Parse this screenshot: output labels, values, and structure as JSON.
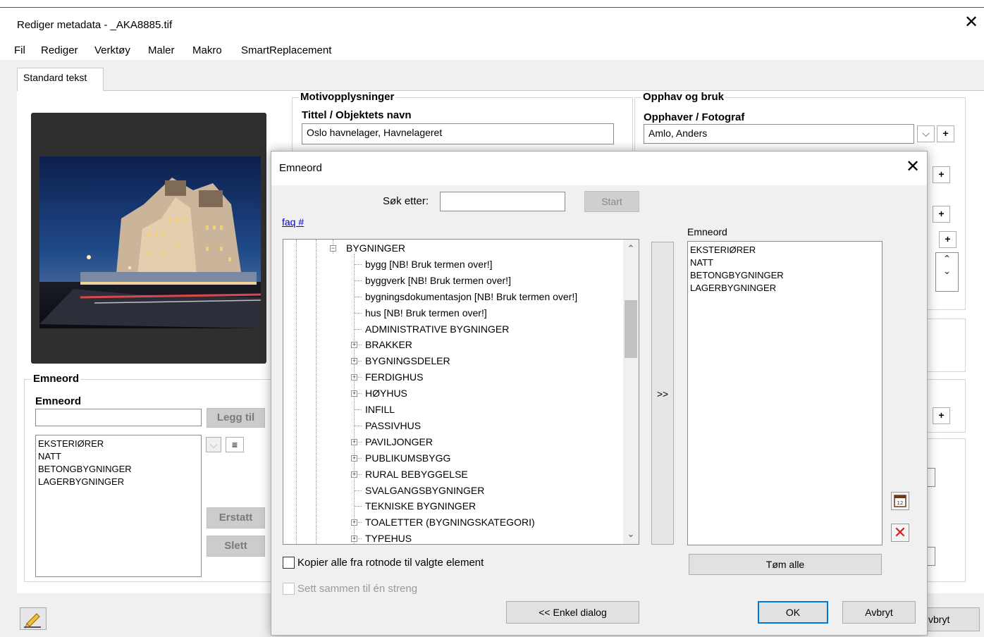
{
  "window": {
    "title": "Rediger metadata - _AKA8885.tif",
    "close": "✕"
  },
  "menu": [
    "Fil",
    "Rediger",
    "Verktøy",
    "Maler",
    "Makro",
    "SmartReplacement"
  ],
  "tab": "Standard tekst",
  "motiv": {
    "group": "Motivopplysninger",
    "title_label": "Tittel / Objektets navn",
    "title_value": "Oslo havnelager, Havnelageret"
  },
  "opphav": {
    "group": "Opphav og bruk",
    "photographer_label": "Opphaver / Fotograf",
    "photographer_value": "Amlo, Anders",
    "dropdown": "⌵",
    "plus": "+",
    "up": "⌃",
    "down": "⌄"
  },
  "emneord_panel": {
    "group": "Emneord",
    "label": "Emneord",
    "input_value": "",
    "add_button": "Legg til",
    "list": [
      "EKSTERIØRER",
      "NATT",
      "BETONGBYGNINGER",
      "LAGERBYGNINGER"
    ],
    "replace_button": "Erstatt",
    "delete_button": "Slett",
    "sort_icon": "≡"
  },
  "footer": {
    "cancel_partial": "vbryt"
  },
  "dialog": {
    "title": "Emneord",
    "close": "✕",
    "search_label": "Søk etter:",
    "search_value": "",
    "start_button": "Start",
    "link": "faq #",
    "transfer_button": ">>",
    "selected_label": "Emneord",
    "selected": [
      "EKSTERIØRER",
      "NATT",
      "BETONGBYGNINGER",
      "LAGERBYGNINGER"
    ],
    "tree": {
      "root": "BYGNINGER",
      "children": [
        {
          "label": "bygg [NB! Bruk termen over!]",
          "expandable": false
        },
        {
          "label": "byggverk [NB! Bruk termen over!]",
          "expandable": false
        },
        {
          "label": "bygningsdokumentasjon [NB! Bruk termen over!]",
          "expandable": false
        },
        {
          "label": "hus [NB! Bruk termen over!]",
          "expandable": false
        },
        {
          "label": "ADMINISTRATIVE BYGNINGER",
          "expandable": false
        },
        {
          "label": "BRAKKER",
          "expandable": true
        },
        {
          "label": "BYGNINGSDELER",
          "expandable": true
        },
        {
          "label": "FERDIGHUS",
          "expandable": true
        },
        {
          "label": "HØYHUS",
          "expandable": true
        },
        {
          "label": "INFILL",
          "expandable": false
        },
        {
          "label": "PASSIVHUS",
          "expandable": false
        },
        {
          "label": "PAVILJONGER",
          "expandable": true
        },
        {
          "label": "PUBLIKUMSBYGG",
          "expandable": true
        },
        {
          "label": "RURAL BEBYGGELSE",
          "expandable": true
        },
        {
          "label": "SVALGANGSBYGNINGER",
          "expandable": false
        },
        {
          "label": "TEKNISKE BYGNINGER",
          "expandable": false
        },
        {
          "label": "TOALETTER (BYGNINGSKATEGORI)",
          "expandable": true
        },
        {
          "label": "TYPEHUS",
          "expandable": true
        }
      ]
    },
    "checkbox_copy": "Kopier alle fra rotnode til valgte element",
    "checkbox_join": "Sett sammen til én streng",
    "clear_button": "Tøm alle",
    "simple_button": "<< Enkel dialog",
    "ok_button": "OK",
    "cancel_button": "Avbryt",
    "calendar_icon": "12",
    "delete_icon": "✕"
  }
}
